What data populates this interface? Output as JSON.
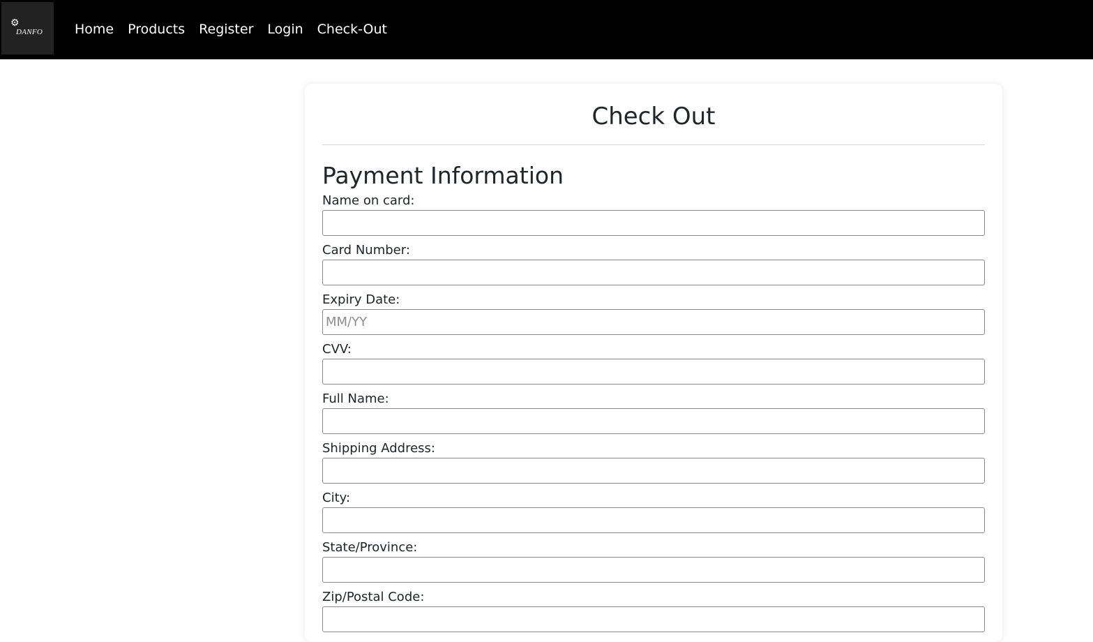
{
  "nav": {
    "logo_text": "DANFO",
    "links": [
      "Home",
      "Products",
      "Register",
      "Login",
      "Check-Out"
    ]
  },
  "checkout": {
    "title": "Check Out",
    "section_title": "Payment Information",
    "fields": [
      {
        "label": "Name on card:",
        "value": "",
        "placeholder": ""
      },
      {
        "label": "Card Number:",
        "value": "",
        "placeholder": ""
      },
      {
        "label": "Expiry Date:",
        "value": "",
        "placeholder": "MM/YY"
      },
      {
        "label": "CVV:",
        "value": "",
        "placeholder": ""
      },
      {
        "label": "Full Name:",
        "value": "",
        "placeholder": ""
      },
      {
        "label": "Shipping Address:",
        "value": "",
        "placeholder": ""
      },
      {
        "label": "City:",
        "value": "",
        "placeholder": ""
      },
      {
        "label": "State/Province:",
        "value": "",
        "placeholder": ""
      },
      {
        "label": "Zip/Postal Code:",
        "value": "",
        "placeholder": ""
      }
    ]
  },
  "colors": {
    "navbar_bg": "#000000",
    "logo_bg": "#222222",
    "text": "#212529",
    "input_border": "#8a8a8a"
  }
}
